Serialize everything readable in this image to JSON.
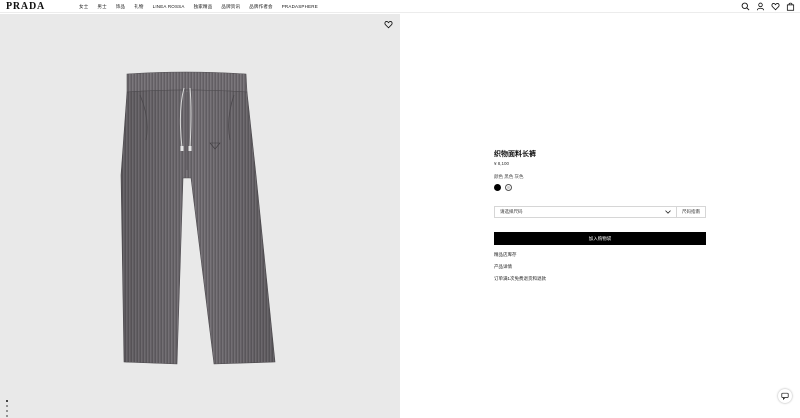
{
  "header": {
    "logo": "PRADA",
    "nav": [
      "女士",
      "男士",
      "饰品",
      "礼物",
      "LINEA ROSSA",
      "独家精品",
      "品牌资讯",
      "品牌作者会",
      "PRADASPHERE"
    ],
    "icons": [
      "search-icon",
      "account-icon",
      "wishlist-icon",
      "bag-icon"
    ]
  },
  "gallery": {
    "wishlist_icon": "heart-icon",
    "dots_count": 4,
    "active_dot": 0
  },
  "product": {
    "title": "织物面料长裤",
    "price": "¥ 8,100",
    "colors_label": "颜色  黑色  灰色",
    "swatches": [
      {
        "name": "black",
        "color": "#000000"
      },
      {
        "name": "grey",
        "color": "#cfcfcf"
      }
    ],
    "size_placeholder": "请选择尺码",
    "size_guide": "尺码指南",
    "add_to_cart": "加入购物袋",
    "links": [
      "精品店库存",
      "产品详情",
      "订单满1次免费退货和退款"
    ]
  },
  "colors": {
    "pants_base": "#6e6a6f",
    "background": "#e9e9e9",
    "button": "#000000"
  }
}
